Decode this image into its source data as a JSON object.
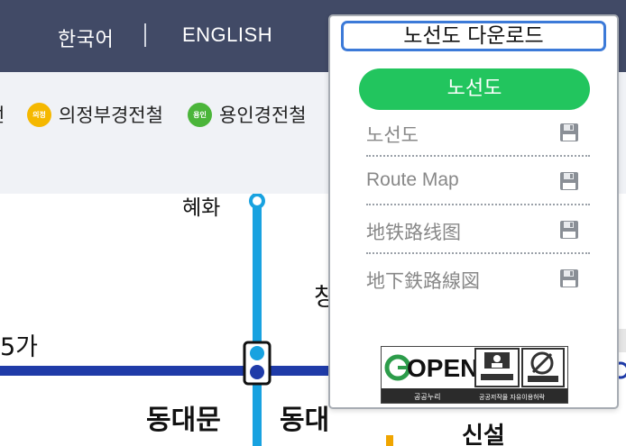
{
  "header": {
    "languages": [
      {
        "label": "한국어"
      },
      {
        "label": "ENGLISH"
      }
    ]
  },
  "lines": [
    {
      "badge": "",
      "label": "선",
      "color": ""
    },
    {
      "badge": "의정",
      "label": "의정부경전철",
      "color": "#f5b800"
    },
    {
      "badge": "용인",
      "label": "용인경전철",
      "color": "#4bb53a"
    }
  ],
  "map": {
    "stations": [
      {
        "label": "혜화"
      },
      {
        "label": "5가"
      },
      {
        "label": "동대문"
      },
      {
        "label": "동대"
      },
      {
        "label": "창"
      },
      {
        "label": "신설"
      }
    ]
  },
  "download": {
    "title": "노선도 다운로드",
    "primary_button": "노선도",
    "items": [
      {
        "label": "노선도"
      },
      {
        "label": "Route Map"
      },
      {
        "label": "地铁路线图"
      },
      {
        "label": "地下鉄路線図"
      }
    ],
    "license": {
      "logo_text": "OPEN",
      "caption_left": "공공누리",
      "caption_right": "공공저작물 자유이용허락"
    }
  },
  "colors": {
    "header_bg": "#414a66",
    "line4": "#18a2e0",
    "line1": "#1f3ba8",
    "accent_green": "#22c55e",
    "focus_blue": "#3c7ad8"
  }
}
